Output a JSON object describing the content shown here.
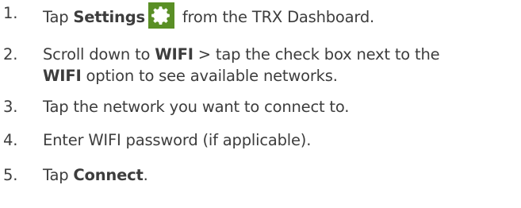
{
  "steps": [
    {
      "number": "1.",
      "parts": {
        "a": "Tap ",
        "b": "Settings",
        "c": " from the TRX Dashboard."
      }
    },
    {
      "number": "2.",
      "parts": {
        "a": "Scroll down to ",
        "b": "WIFI",
        "c": " > tap the check box next to the",
        "d": "WIFI",
        "e": " option to see available networks."
      }
    },
    {
      "number": "3.",
      "text": "Tap the network you want to connect to."
    },
    {
      "number": "4.",
      "text": "Enter WIFI password (if applicable)."
    },
    {
      "number": "5.",
      "parts": {
        "a": "Tap ",
        "b": "Connect",
        "c": "."
      }
    }
  ],
  "icons": {
    "settings": "gear-icon",
    "settings_bg": "#5a8f26",
    "settings_fg": "#ffffff"
  }
}
